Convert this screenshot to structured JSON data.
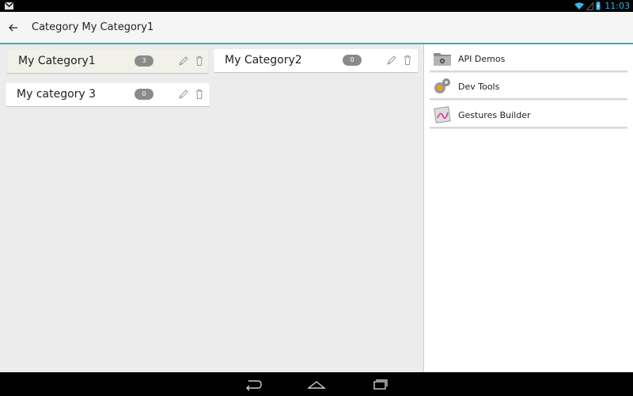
{
  "status_bar": {
    "time": "11:03"
  },
  "action_bar": {
    "title": "Category My Category1"
  },
  "categories": [
    {
      "label": "My Category1",
      "count": "3"
    },
    {
      "label": "My Category2",
      "count": "0"
    },
    {
      "label": "My category 3",
      "count": "0"
    }
  ],
  "apps": [
    {
      "label": "API Demos",
      "icon": "folder-gear-icon"
    },
    {
      "label": "Dev Tools",
      "icon": "dev-tools-gear-icon"
    },
    {
      "label": "Gestures Builder",
      "icon": "gestures-icon"
    }
  ],
  "colors": {
    "accent": "#35b3a8",
    "status_time": "#33b5e5",
    "badge": "#8a8a8a"
  }
}
